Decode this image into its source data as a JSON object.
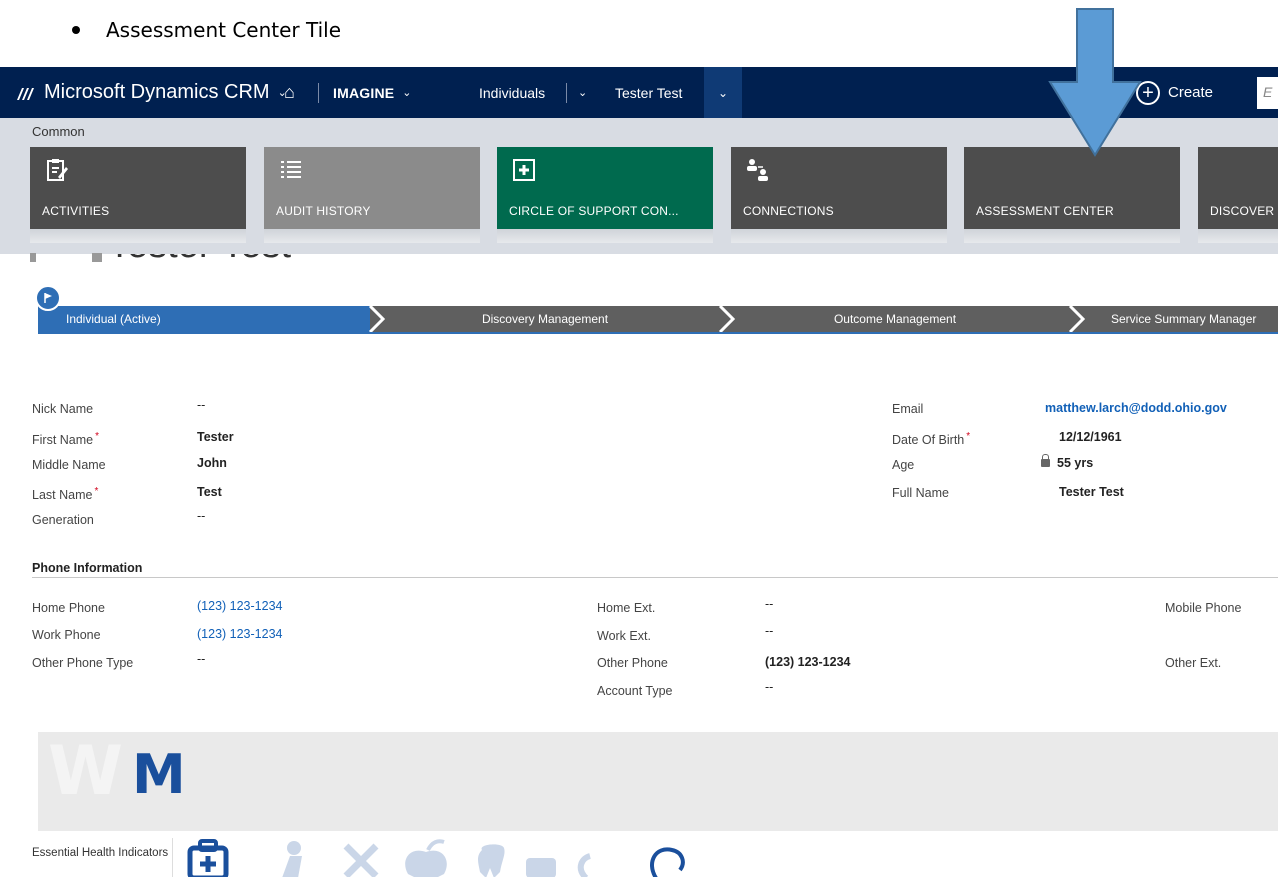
{
  "doc": {
    "bullet_text": "Assessment Center Tile"
  },
  "nav": {
    "app_name": "Microsoft Dynamics CRM",
    "area": "IMAGINE",
    "entity": "Individuals",
    "record": "Tester Test",
    "create_label": "Create",
    "search_placeholder": "E"
  },
  "tiles": {
    "group_label": "Common",
    "items": [
      {
        "label": "ACTIVITIES",
        "icon": "clipboard-icon"
      },
      {
        "label": "AUDIT HISTORY",
        "icon": "list-icon"
      },
      {
        "label": "CIRCLE OF SUPPORT CON...",
        "icon": "puzzle-icon"
      },
      {
        "label": "CONNECTIONS",
        "icon": "people-icon"
      },
      {
        "label": "ASSESSMENT CENTER",
        "icon": ""
      },
      {
        "label": "DISCOVER",
        "icon": ""
      }
    ]
  },
  "record": {
    "title": "Tester Test"
  },
  "process": {
    "stages": [
      {
        "label": "Individual (Active)",
        "active": true
      },
      {
        "label": "Discovery Management",
        "active": false
      },
      {
        "label": "Outcome Management",
        "active": false
      },
      {
        "label": "Service Summary Manager",
        "active": false
      }
    ]
  },
  "general": {
    "nick_name": {
      "label": "Nick Name",
      "value": "--"
    },
    "first_name": {
      "label": "First Name",
      "value": "Tester"
    },
    "middle_name": {
      "label": "Middle Name",
      "value": "John"
    },
    "last_name": {
      "label": "Last Name",
      "value": "Test"
    },
    "generation": {
      "label": "Generation",
      "value": "--"
    },
    "email": {
      "label": "Email",
      "value": "matthew.larch@dodd.ohio.gov"
    },
    "dob": {
      "label": "Date Of Birth",
      "value": "12/12/1961"
    },
    "age": {
      "label": "Age",
      "value": "55 yrs"
    },
    "full_name": {
      "label": "Full Name",
      "value": "Tester Test"
    }
  },
  "phone": {
    "section_title": "Phone Information",
    "home_phone": {
      "label": "Home Phone",
      "value": "(123) 123-1234"
    },
    "work_phone": {
      "label": "Work Phone",
      "value": "(123) 123-1234"
    },
    "other_phone_type": {
      "label": "Other Phone Type",
      "value": "--"
    },
    "home_ext": {
      "label": "Home Ext.",
      "value": "--"
    },
    "work_ext": {
      "label": "Work Ext.",
      "value": "--"
    },
    "other_phone": {
      "label": "Other Phone",
      "value": "(123) 123-1234"
    },
    "account_type": {
      "label": "Account Type",
      "value": "--"
    },
    "mobile_phone": {
      "label": "Mobile Phone"
    },
    "other_ext": {
      "label": "Other Ext."
    }
  },
  "lower": {
    "banner_letters": "M",
    "ehi_label": "Essential Health Indicators"
  },
  "colors": {
    "nav_bg": "#002050",
    "tile_dark": "#4d4d4d",
    "tile_green": "#006a4e",
    "process_active": "#2e6eb5",
    "link": "#1160b7",
    "arrow": "#5b9bd5"
  }
}
